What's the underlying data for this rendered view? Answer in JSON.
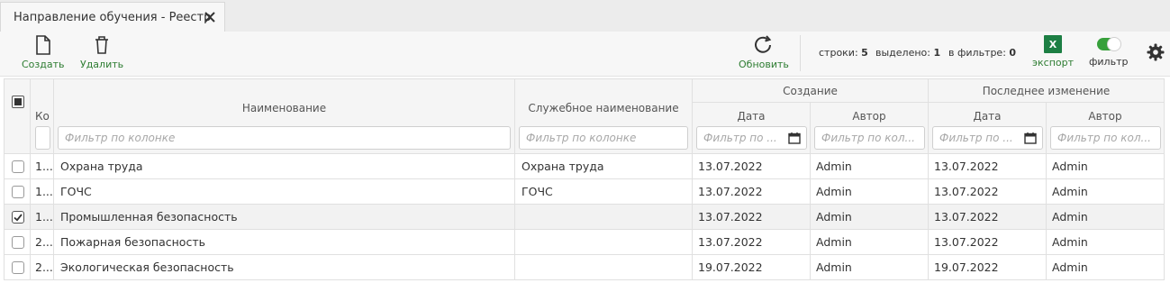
{
  "tab": {
    "title": "Направление обучения - Реестр"
  },
  "toolbar": {
    "create_label": "Создать",
    "delete_label": "Удалить",
    "refresh_label": "Обновить",
    "export_label": "экспорт",
    "export_icon_text": "X",
    "filter_label": "фильтр",
    "filter_enabled": true,
    "stats": {
      "rows_label": "строки:",
      "rows_value": "5",
      "selected_label": "выделено:",
      "selected_value": "1",
      "filtered_label": "в фильтре:",
      "filtered_value": "0"
    }
  },
  "grid": {
    "headers": {
      "code": "Ко",
      "name": "Наименование",
      "service_name": "Служебное наименование",
      "created_group": "Создание",
      "modified_group": "Последнее изменение",
      "date": "Дата",
      "author": "Автор"
    },
    "filter_placeholders": {
      "code": "",
      "name": "Фильтр по колонке",
      "service_name": "Фильтр по колонке",
      "created_date": "Фильтр по ...",
      "created_author": "Фильтр по кол...",
      "modified_date": "Фильтр по ...",
      "modified_author": "Фильтр по кол..."
    },
    "rows": [
      {
        "checked": false,
        "code": "1...",
        "name": "Охрана труда",
        "service_name": "Охрана труда",
        "created_date": "13.07.2022",
        "created_author": "Admin",
        "modified_date": "13.07.2022",
        "modified_author": "Admin"
      },
      {
        "checked": false,
        "code": "1...",
        "name": "ГОЧС",
        "service_name": "ГОЧС",
        "created_date": "13.07.2022",
        "created_author": "Admin",
        "modified_date": "13.07.2022",
        "modified_author": "Admin"
      },
      {
        "checked": true,
        "code": "1...",
        "name": "Промышленная безопасность",
        "service_name": "",
        "created_date": "13.07.2022",
        "created_author": "Admin",
        "modified_date": "13.07.2022",
        "modified_author": "Admin"
      },
      {
        "checked": false,
        "code": "2...",
        "name": "Пожарная безопасность",
        "service_name": "",
        "created_date": "13.07.2022",
        "created_author": "Admin",
        "modified_date": "13.07.2022",
        "modified_author": "Admin"
      },
      {
        "checked": false,
        "code": "2...",
        "name": "Экологическая безопасность",
        "service_name": "",
        "created_date": "19.07.2022",
        "created_author": "Admin",
        "modified_date": "19.07.2022",
        "modified_author": "Admin"
      }
    ]
  },
  "colors": {
    "accent_green": "#2e7d32",
    "excel_green": "#1d7f44",
    "toggle_green": "#37a03b",
    "selected_row": "#f2f2f2"
  }
}
